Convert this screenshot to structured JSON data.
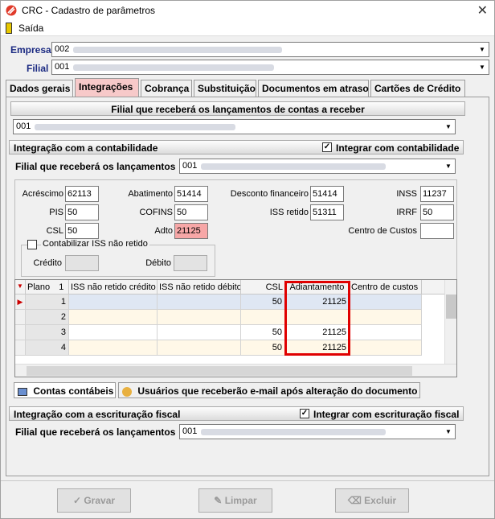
{
  "window": {
    "title": "CRC - Cadastro de parâmetros",
    "close_glyph": "✕"
  },
  "menu": {
    "exit_label": "Saída"
  },
  "header": {
    "empresa_label": "Empresa",
    "empresa_value": "002",
    "filial_label": "Filial",
    "filial_value": "001"
  },
  "tabs": [
    "Dados gerais",
    "Integrações",
    "Cobrança",
    "Substituição",
    "Documentos em atraso",
    "Cartões de Crédito"
  ],
  "active_tab": "Integrações",
  "receivable": {
    "title": "Filial que receberá os lançamentos de contas a receber",
    "value": "001"
  },
  "accounting": {
    "title": "Integração com a contabilidade",
    "integrate_label": "Integrar com contabilidade",
    "integrate_checked": true,
    "branch_label": "Filial que receberá os lançamentos",
    "branch_value": "001",
    "fields": {
      "acrescimo_label": "Acréscimo",
      "acrescimo": "62113",
      "abatimento_label": "Abatimento",
      "abatimento": "51414",
      "desconto_label": "Desconto financeiro",
      "desconto": "51414",
      "inss_label": "INSS",
      "inss": "11237",
      "pis_label": "PIS",
      "pis": "50",
      "cofins_label": "COFINS",
      "cofins": "50",
      "iss_retido_label": "ISS retido",
      "iss_retido": "51311",
      "irrf_label": "IRRF",
      "irrf": "50",
      "csl_label": "CSL",
      "csl": "50",
      "adto_label": "Adto",
      "adto": "21125",
      "centro_label": "Centro de Custos",
      "centro": ""
    },
    "iss_group": {
      "label": "Contabilizar ISS não retido",
      "checked": false,
      "credito_label": "Crédito",
      "debito_label": "Débito"
    }
  },
  "grid": {
    "columns": [
      "Plano",
      "ISS não retido crédito",
      "ISS não retido débito",
      "CSL",
      "Adiantamento",
      "Centro de custos"
    ],
    "sort_indicator": "1",
    "rows": [
      {
        "plano": "1",
        "iss_cred": "",
        "iss_deb": "",
        "csl": "50",
        "adiantamento": "21125",
        "centro": ""
      },
      {
        "plano": "2",
        "iss_cred": "",
        "iss_deb": "",
        "csl": "",
        "adiantamento": "",
        "centro": ""
      },
      {
        "plano": "3",
        "iss_cred": "",
        "iss_deb": "",
        "csl": "50",
        "adiantamento": "21125",
        "centro": ""
      },
      {
        "plano": "4",
        "iss_cred": "",
        "iss_deb": "",
        "csl": "50",
        "adiantamento": "21125",
        "centro": ""
      }
    ],
    "highlight_color": "#e00000"
  },
  "bottom_tabs": [
    "Contas contábeis",
    "Usuários que receberão e-mail após alteração do documento"
  ],
  "fiscal": {
    "title": "Integração com a escrituração fiscal",
    "integrate_label": "Integrar com escrituração fiscal",
    "integrate_checked": true,
    "branch_label": "Filial que receberá os lançamentos",
    "branch_value": "001"
  },
  "buttons": {
    "save": "Gravar",
    "clear": "Limpar",
    "delete": "Excluir"
  },
  "icons": {
    "app": "crc-logo-icon",
    "exit": "door-icon",
    "dropdown": "▼",
    "check": "✓",
    "row_marker": "▶",
    "sort": "▼"
  }
}
